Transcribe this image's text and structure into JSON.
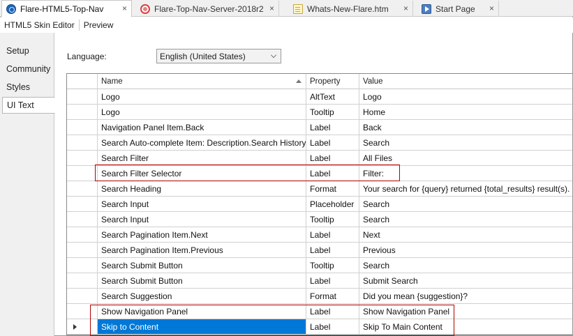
{
  "tabs": [
    {
      "label": "Flare-HTML5-Top-Nav",
      "icon": "globe-icon",
      "active": true,
      "closable": true
    },
    {
      "label": "Flare-Top-Nav-Server-2018r2",
      "icon": "target-icon",
      "active": false,
      "closable": true
    },
    {
      "label": "Whats-New-Flare.htm",
      "icon": "file-icon",
      "active": false,
      "closable": true
    },
    {
      "label": "Start Page",
      "icon": "start-page-icon",
      "active": false,
      "closable": true
    }
  ],
  "close_glyph": "×",
  "subbar": {
    "title": "HTML5 Skin Editor",
    "preview": "Preview"
  },
  "sidebar": {
    "items": [
      {
        "label": "Setup"
      },
      {
        "label": "Community"
      },
      {
        "label": "Styles"
      },
      {
        "label": "UI Text"
      }
    ],
    "active": "UI Text"
  },
  "language": {
    "label": "Language:",
    "value": "English (United States)"
  },
  "grid": {
    "columns": {
      "name": "Name",
      "property": "Property",
      "value": "Value"
    },
    "sort_column": "Name",
    "sort_direction": "ascending",
    "rows": [
      {
        "name": "Logo",
        "property": "AltText",
        "value": "Logo"
      },
      {
        "name": "Logo",
        "property": "Tooltip",
        "value": "Home"
      },
      {
        "name": "Navigation Panel Item.Back",
        "property": "Label",
        "value": "Back"
      },
      {
        "name": "Search Auto-complete Item: Description.Search History",
        "property": "Label",
        "value": "Search"
      },
      {
        "name": "Search Filter",
        "property": "Label",
        "value": "All Files"
      },
      {
        "name": "Search Filter Selector",
        "property": "Label",
        "value": "Filter:"
      },
      {
        "name": "Search Heading",
        "property": "Format",
        "value": "Your search for {query} returned {total_results} result(s)."
      },
      {
        "name": "Search Input",
        "property": "Placeholder",
        "value": "Search"
      },
      {
        "name": "Search Input",
        "property": "Tooltip",
        "value": "Search"
      },
      {
        "name": "Search Pagination Item.Next",
        "property": "Label",
        "value": "Next"
      },
      {
        "name": "Search Pagination Item.Previous",
        "property": "Label",
        "value": "Previous"
      },
      {
        "name": "Search Submit Button",
        "property": "Tooltip",
        "value": "Search"
      },
      {
        "name": "Search Submit Button",
        "property": "Label",
        "value": "Submit Search"
      },
      {
        "name": "Search Suggestion",
        "property": "Format",
        "value": "Did you mean {suggestion}?"
      },
      {
        "name": "Show Navigation Panel",
        "property": "Label",
        "value": "Show Navigation Panel"
      },
      {
        "name": "Skip to Content",
        "property": "Label",
        "value": "Skip To Main Content",
        "selected": true
      }
    ]
  },
  "colors": {
    "selection": "#0078d7",
    "highlight_box": "#b00000"
  }
}
